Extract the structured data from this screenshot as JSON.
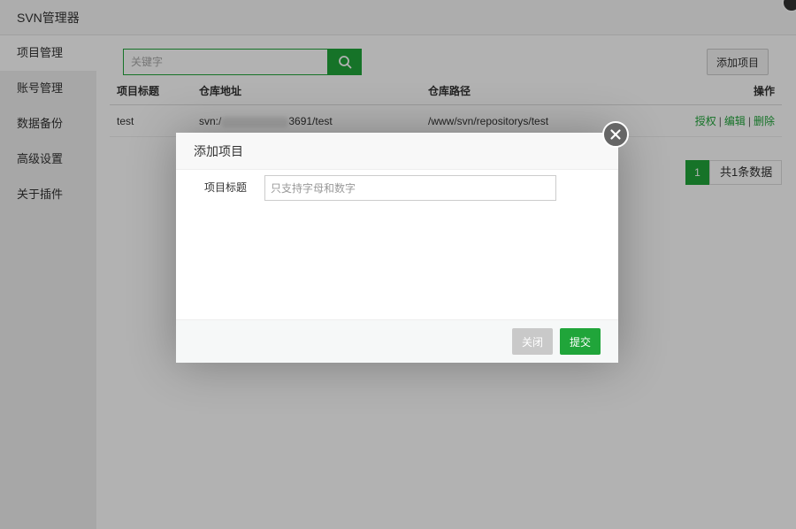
{
  "window": {
    "title": "SVN管理器"
  },
  "sidebar": {
    "items": [
      {
        "label": "项目管理"
      },
      {
        "label": "账号管理"
      },
      {
        "label": "数据备份"
      },
      {
        "label": "高级设置"
      },
      {
        "label": "关于插件"
      }
    ]
  },
  "toolbar": {
    "search_placeholder": "关键字",
    "add_label": "添加项目"
  },
  "table": {
    "headers": [
      "项目标题",
      "仓库地址",
      "仓库路径",
      "操作"
    ],
    "rows": [
      {
        "title": "test",
        "address_prefix": "svn:/",
        "address_suffix": "3691/test",
        "path": "/www/svn/repositorys/test",
        "actions": [
          "授权",
          "编辑",
          "删除"
        ]
      }
    ]
  },
  "pager": {
    "current": "1",
    "total": "共1条数据"
  },
  "modal": {
    "title": "添加项目",
    "field_label": "项目标题",
    "field_placeholder": "只支持字母和数字",
    "field_value": "",
    "close_label": "关闭",
    "submit_label": "提交"
  },
  "colors": {
    "accent": "#20a53a",
    "overlay": "rgba(0,0,0,0.3)"
  },
  "icons": {
    "search": "search-icon",
    "close": "close-icon"
  }
}
